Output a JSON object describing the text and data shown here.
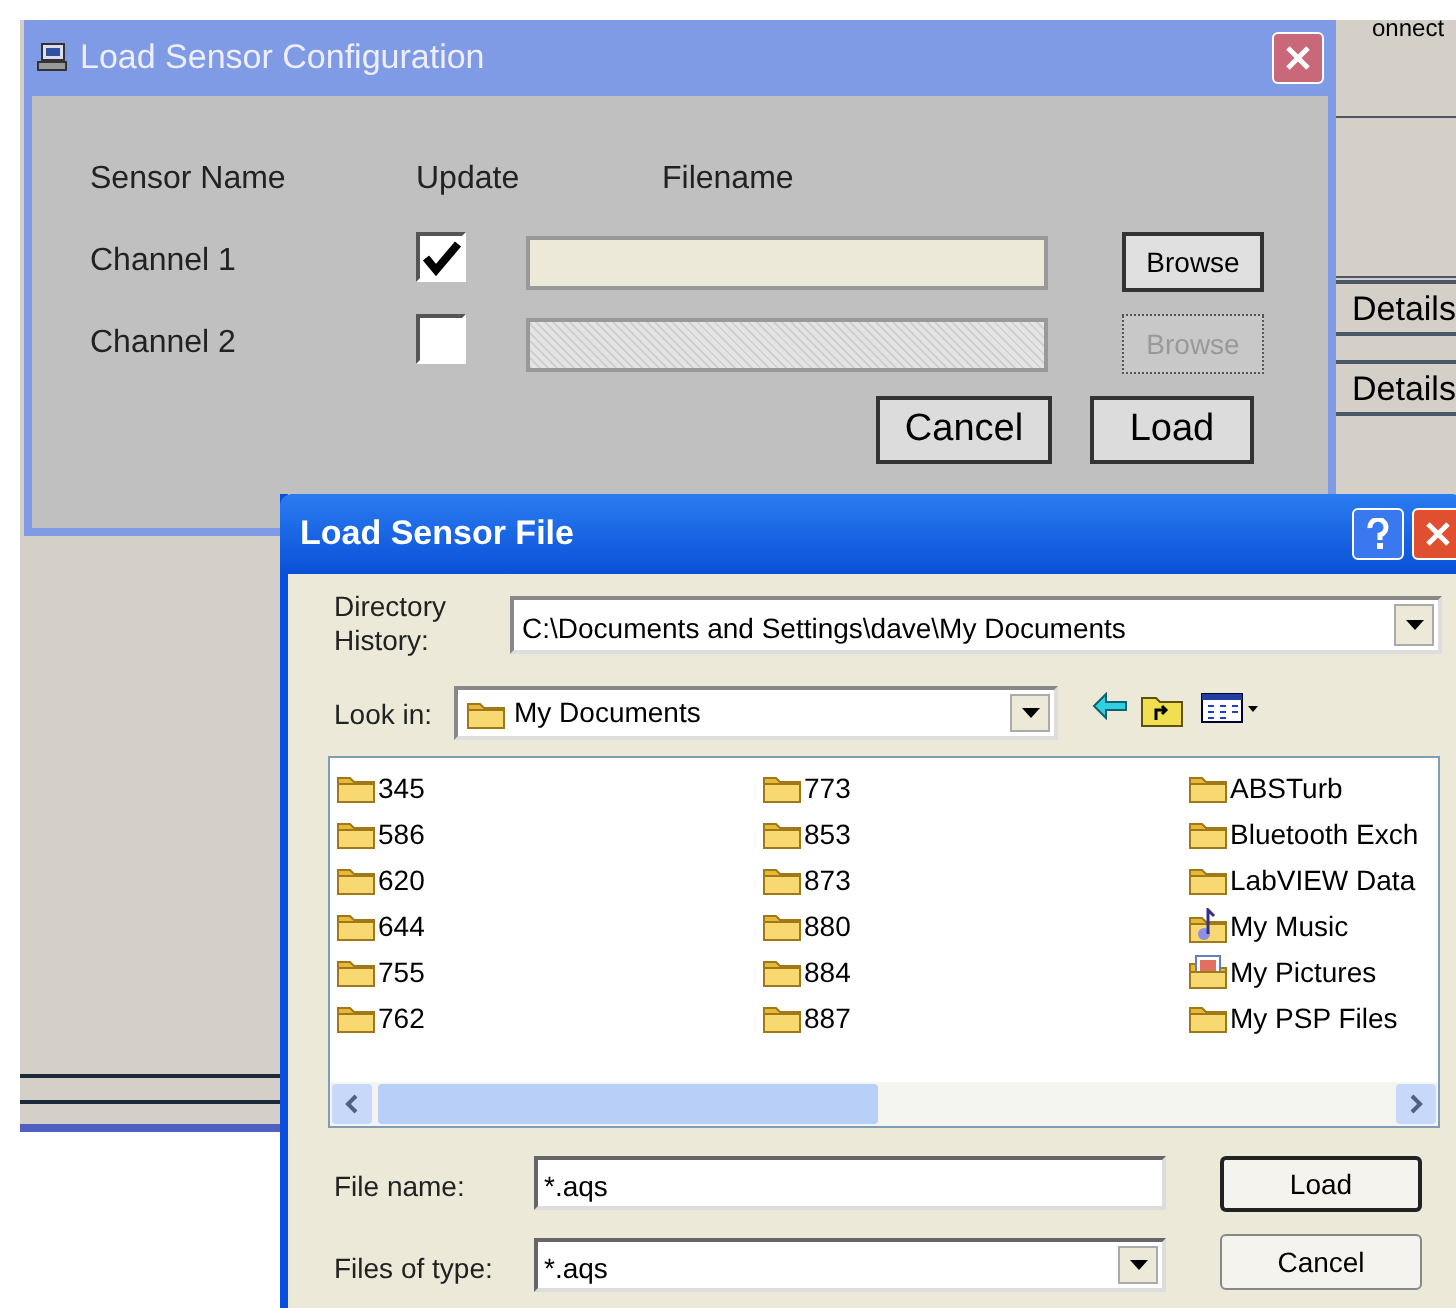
{
  "background_window": {
    "header_text": "onnect",
    "buttons": [
      "Details",
      "Details"
    ]
  },
  "config_dialog": {
    "title": "Load Sensor Configuration",
    "columns": [
      "Sensor Name",
      "Update",
      "Filename"
    ],
    "channels": [
      {
        "name": "Channel 1",
        "checked": true,
        "disabled": false,
        "browse": "Browse"
      },
      {
        "name": "Channel 2",
        "checked": false,
        "disabled": true,
        "browse": "Browse"
      }
    ],
    "buttons": [
      "Cancel",
      "Load"
    ]
  },
  "file_dialog": {
    "title": "Load Sensor File",
    "directory_history": {
      "label": "Directory History:",
      "value": "C:\\Documents and Settings\\dave\\My Documents"
    },
    "look_in": {
      "label": "Look in:",
      "value": "My Documents"
    },
    "columns": [
      [
        {
          "name": "345",
          "kind": "folder"
        },
        {
          "name": "586",
          "kind": "folder"
        },
        {
          "name": "620",
          "kind": "folder"
        },
        {
          "name": "644",
          "kind": "folder"
        },
        {
          "name": "755",
          "kind": "folder"
        },
        {
          "name": "762",
          "kind": "folder"
        }
      ],
      [
        {
          "name": "773",
          "kind": "folder"
        },
        {
          "name": "853",
          "kind": "folder"
        },
        {
          "name": "873",
          "kind": "folder"
        },
        {
          "name": "880",
          "kind": "folder"
        },
        {
          "name": "884",
          "kind": "folder"
        },
        {
          "name": "887",
          "kind": "folder"
        }
      ],
      [
        {
          "name": "ABSTurb",
          "kind": "folder"
        },
        {
          "name": "Bluetooth Exch",
          "kind": "folder"
        },
        {
          "name": "LabVIEW Data",
          "kind": "folder"
        },
        {
          "name": "My Music",
          "kind": "music"
        },
        {
          "name": "My Pictures",
          "kind": "pictures"
        },
        {
          "name": "My PSP Files",
          "kind": "folder"
        }
      ]
    ],
    "file_name": {
      "label": "File name:",
      "value": "*.aqs"
    },
    "file_type": {
      "label": "Files of type:",
      "value": "*.aqs"
    },
    "buttons": [
      "Load",
      "Cancel"
    ]
  }
}
